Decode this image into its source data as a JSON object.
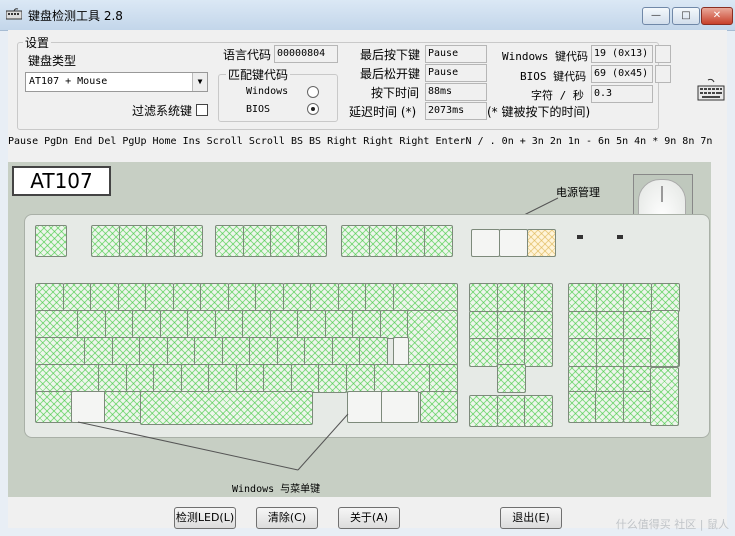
{
  "window": {
    "title": "键盘检测工具 2.8",
    "min": "—",
    "max": "□",
    "close": "✕"
  },
  "settings": {
    "group_label": "设置",
    "kb_type_label": "键盘类型",
    "kb_type_value": "AT107 + Mouse",
    "filter_label": "过滤系统键",
    "lang_label": "语言代码",
    "lang_value": "00000804",
    "match_label": "匹配键代码",
    "windows_label": "Windows",
    "bios_label": "BIOS",
    "last_press_label": "最后按下键",
    "last_press_value": "Pause",
    "last_release_label": "最后松开键",
    "last_release_value": "Pause",
    "press_time_label": "按下时间",
    "press_time_value": "88ms",
    "delay_label": "延迟时间 (*)",
    "delay_value": "2073ms",
    "delay_note": "(* 键被按下的时间)",
    "win_code_label": "Windows 键代码",
    "win_code_value": "19 (0x13)",
    "bios_code_label": "BIOS 键代码",
    "bios_code_value": "69 (0x45)",
    "char_label": "字符 / 秒",
    "char_value": "0.3"
  },
  "key_history": "Pause PgDn End Del PgUp Home Ins Scroll Scroll BS BS Right Right Right EnterN / . 0n + 3n 2n 1n - 6n 5n 4n * 9n 8n 7n",
  "keyboard": {
    "badge": "AT107",
    "power_label": "电源管理",
    "winmenu_label": "Windows 与菜单键"
  },
  "buttons": {
    "detect_led": "检测LED(L)",
    "clear": "清除(C)",
    "about": "关于(A)",
    "exit": "退出(E)"
  },
  "watermark": "什么值得买 社区 | 鼠人"
}
